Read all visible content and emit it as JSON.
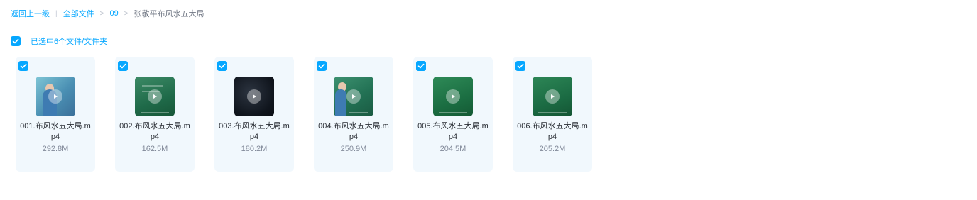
{
  "breadcrumb": {
    "back": "返回上一级",
    "all_files": "全部文件",
    "folder": "09",
    "current": "张敬平布风水五大局",
    "sep_bar": "|",
    "sep_arrow": ">"
  },
  "selection": {
    "text": "已选中6个文件/文件夹"
  },
  "accent_color": "#06a7ff",
  "icons": {
    "checkbox": "checkbox-checked-icon",
    "play": "play-icon"
  },
  "files": [
    {
      "name": "001.布风水五大局.mp4",
      "size": "292.8M"
    },
    {
      "name": "002.布风水五大局.mp4",
      "size": "162.5M"
    },
    {
      "name": "003.布风水五大局.mp4",
      "size": "180.2M"
    },
    {
      "name": "004.布风水五大局.mp4",
      "size": "250.9M"
    },
    {
      "name": "005.布风水五大局.mp4",
      "size": "204.5M"
    },
    {
      "name": "006.布风水五大局.mp4",
      "size": "205.2M"
    }
  ]
}
